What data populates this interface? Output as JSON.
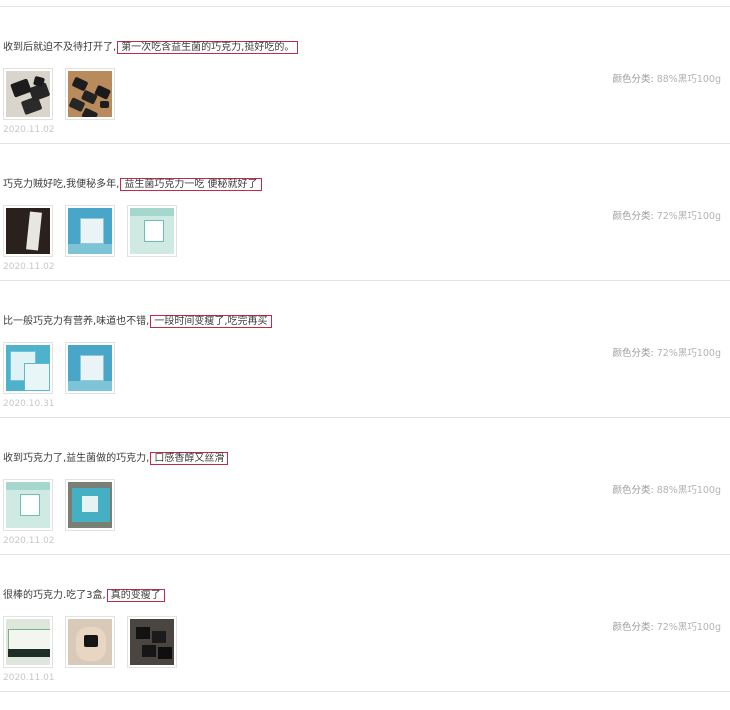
{
  "spec_label": "颜色分类:",
  "reviews": [
    {
      "text": "收到后就迫不及待打开了,",
      "highlight": "第一次吃含益生菌的巧克力,挺好吃的。",
      "date": "2020.11.02",
      "spec": "88%黑巧100g",
      "thumbs": [
        "dark-pieces",
        "pieces-wood"
      ]
    },
    {
      "text": "巧克力贼好吃,我便秘多年,",
      "highlight": "益生菌巧克力一吃 便秘就好了",
      "date": "2020.11.02",
      "spec": "72%黑巧100g",
      "thumbs": [
        "dark-box",
        "teal-box",
        "mint-box"
      ]
    },
    {
      "text": "比一般巧克力有营养,味道也不错,",
      "highlight": "一段时间变瘦了,吃完再买",
      "date": "2020.10.31",
      "spec": "72%黑巧100g",
      "thumbs": [
        "double-box",
        "teal-box"
      ]
    },
    {
      "text": "收到巧克力了,益生菌做的巧克力,",
      "highlight": "口感香醇又丝滑",
      "date": "2020.11.02",
      "spec": "88%黑巧100g",
      "thumbs": [
        "mint-box",
        "box-floor"
      ]
    },
    {
      "text": "很棒的巧克力.吃了3盒,",
      "highlight": "真的变瘦了",
      "date": "2020.11.01",
      "spec": "72%黑巧100g",
      "thumbs": [
        "card",
        "hand",
        "dark-pile"
      ]
    }
  ]
}
